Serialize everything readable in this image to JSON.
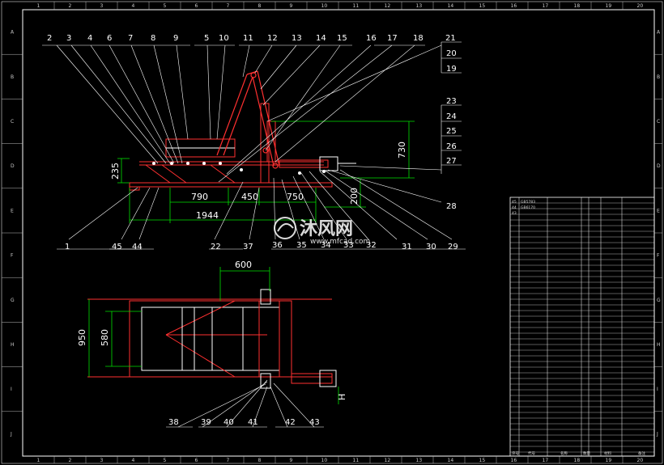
{
  "grid": {
    "cols": [
      "1",
      "2",
      "3",
      "4",
      "5",
      "6",
      "7",
      "8",
      "9",
      "10",
      "11",
      "12",
      "13",
      "14",
      "15",
      "16",
      "17",
      "18",
      "19",
      "20"
    ],
    "rows": [
      "A",
      "B",
      "C",
      "D",
      "E",
      "F",
      "G",
      "H",
      "I",
      "J"
    ]
  },
  "side_view": {
    "top_leaders": [
      "2",
      "3",
      "4",
      "6",
      "7",
      "8",
      "9",
      "5",
      "10",
      "11",
      "12",
      "13",
      "14",
      "15",
      "16",
      "17",
      "18",
      "21"
    ],
    "right_leaders": [
      "20",
      "19",
      "23",
      "24",
      "25",
      "26",
      "27"
    ],
    "bottom_leaders": [
      "1",
      "45",
      "44",
      "22",
      "37",
      "36",
      "35",
      "34",
      "33",
      "32",
      "31",
      "30",
      "29"
    ],
    "extra_leader": "28",
    "dims": {
      "d235": "235",
      "d790": "790",
      "d450": "450",
      "d750": "750",
      "d1944": "1944",
      "d730": "730",
      "d200": "200"
    }
  },
  "top_view": {
    "dims": {
      "d600": "600",
      "d950": "950",
      "d580": "580",
      "dH": "H"
    },
    "bottom_leaders": [
      "38",
      "39",
      "40",
      "41",
      "42",
      "43"
    ]
  },
  "watermark": {
    "title": "沐风网",
    "url": "www.mfcad.com"
  },
  "bom": {
    "top_rows": [
      [
        "45",
        "GB5783",
        "",
        "",
        ""
      ],
      [
        "44",
        "GB6170",
        "",
        "",
        ""
      ],
      [
        "43",
        "",
        "",
        "",
        ""
      ]
    ],
    "footer": [
      "序号",
      "代号",
      "名称",
      "数量",
      "材料",
      "备注"
    ]
  },
  "colors": {
    "background": "#000000",
    "frame": "#ffffff",
    "part": "#ff3030",
    "dimension": "#00e000",
    "leader": "#ffffff"
  }
}
